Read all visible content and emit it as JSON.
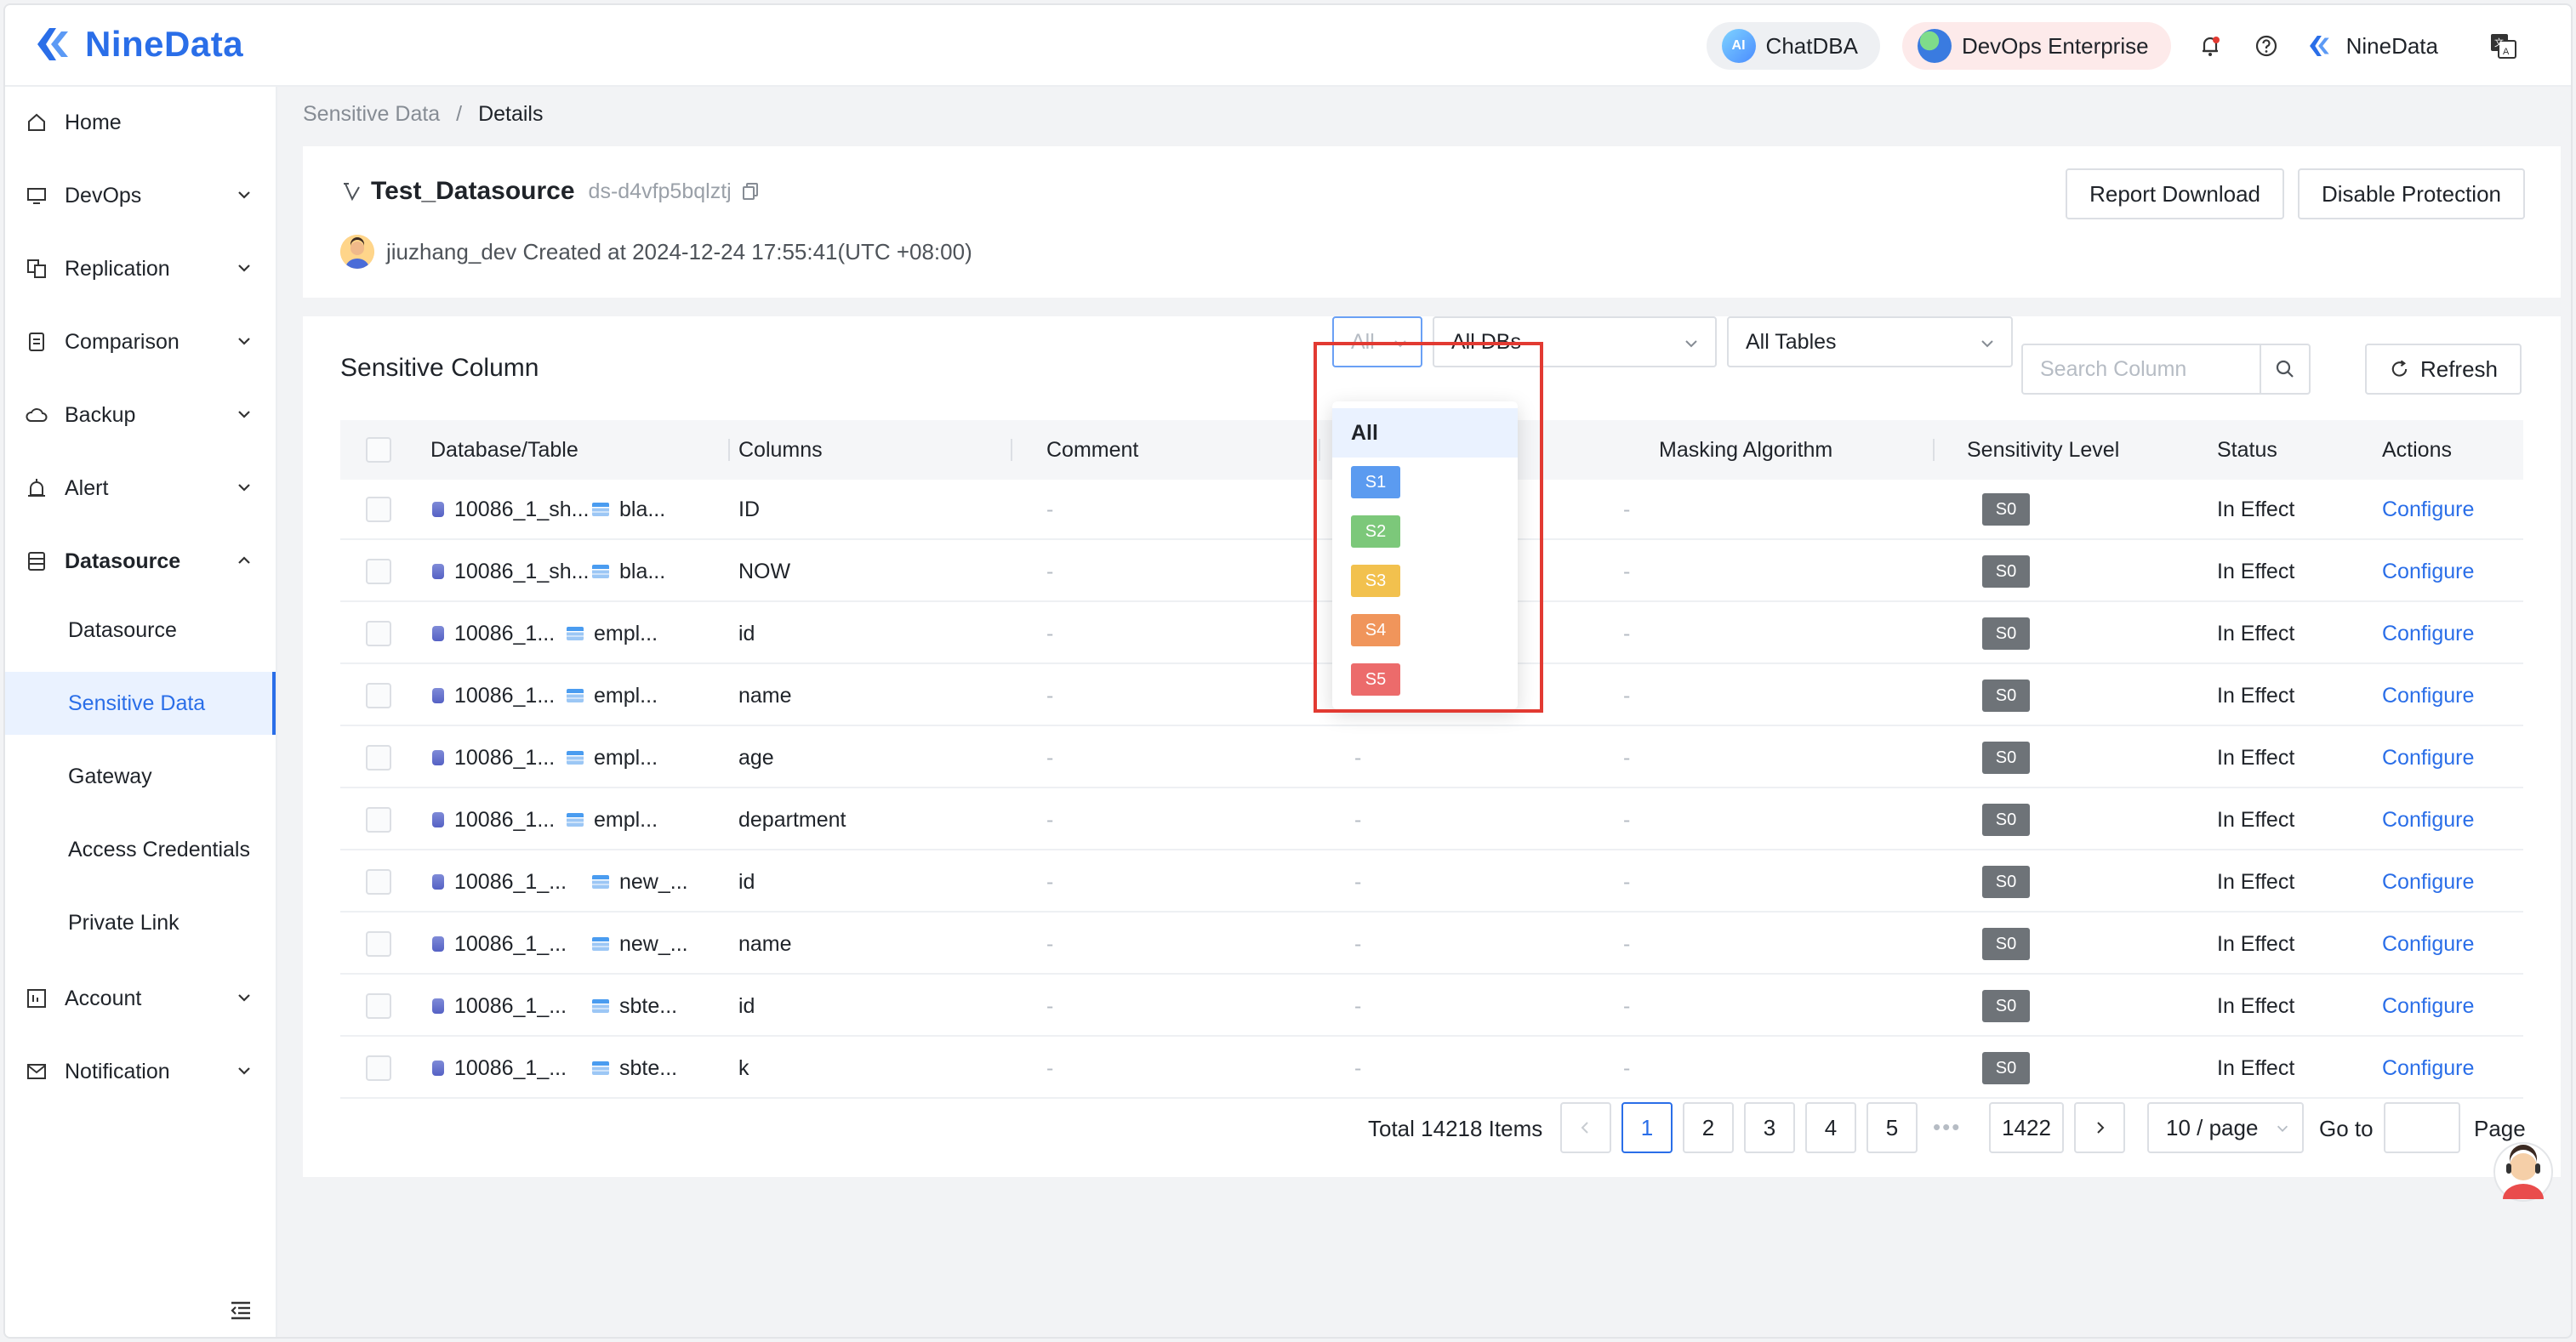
{
  "app": {
    "brand": "NineData",
    "header": {
      "chat_label": "ChatDBA",
      "ai_badge": "AI",
      "enterprise_label": "DevOps Enterprise",
      "user_label": "NineData",
      "notification_icon": "bell-icon",
      "help_icon": "question-icon",
      "language_icon": "translate-icon"
    }
  },
  "sidebar": {
    "items": [
      {
        "label": "Home",
        "icon": "home-icon"
      },
      {
        "label": "DevOps",
        "icon": "monitor-icon"
      },
      {
        "label": "Replication",
        "icon": "replication-icon"
      },
      {
        "label": "Comparison",
        "icon": "compare-icon"
      },
      {
        "label": "Backup",
        "icon": "cloud-icon"
      },
      {
        "label": "Alert",
        "icon": "alarm-icon"
      },
      {
        "label": "Datasource",
        "icon": "database-icon"
      },
      {
        "label": "Account",
        "icon": "account-icon"
      },
      {
        "label": "Notification",
        "icon": "mail-icon"
      }
    ],
    "datasource_sub": [
      "Datasource",
      "Sensitive Data",
      "Gateway",
      "Access Credentials",
      "Private Link"
    ],
    "active_sub": "Sensitive Data"
  },
  "breadcrumb": {
    "parent": "Sensitive Data",
    "sep": "/",
    "current": "Details"
  },
  "datasource": {
    "name": "Test_Datasource",
    "id": "ds-d4vfp5bqlztj",
    "creator_line": "jiuzhang_dev Created at 2024-12-24 17:55:41(UTC +08:00)",
    "report_button": "Report Download",
    "disable_button": "Disable Protection"
  },
  "section": {
    "title": "Sensitive Column",
    "level_filter": "All",
    "db_filter": "All DBs",
    "table_filter": "All Tables",
    "search_placeholder": "Search Column",
    "refresh_label": "Refresh"
  },
  "table": {
    "headers": [
      "Database/Table",
      "Columns",
      "Comment",
      "Masking Algorithm",
      "Sensitivity Level",
      "Status",
      "Actions"
    ],
    "rows": [
      {
        "db": "10086_1_sh...",
        "table": "bla...",
        "column": "ID",
        "comment": "-",
        "classification": "-",
        "masking": "-",
        "level": "S0",
        "status": "In Effect",
        "action": "Configure"
      },
      {
        "db": "10086_1_sh...",
        "table": "bla...",
        "column": "NOW",
        "comment": "-",
        "classification": "-",
        "masking": "-",
        "level": "S0",
        "status": "In Effect",
        "action": "Configure"
      },
      {
        "db": "10086_1...",
        "table": "empl...",
        "column": "id",
        "comment": "-",
        "classification": "-",
        "masking": "-",
        "level": "S0",
        "status": "In Effect",
        "action": "Configure"
      },
      {
        "db": "10086_1...",
        "table": "empl...",
        "column": "name",
        "comment": "-",
        "classification": "-",
        "masking": "-",
        "level": "S0",
        "status": "In Effect",
        "action": "Configure"
      },
      {
        "db": "10086_1...",
        "table": "empl...",
        "column": "age",
        "comment": "-",
        "classification": "-",
        "masking": "-",
        "level": "S0",
        "status": "In Effect",
        "action": "Configure"
      },
      {
        "db": "10086_1...",
        "table": "empl...",
        "column": "department",
        "comment": "-",
        "classification": "-",
        "masking": "-",
        "level": "S0",
        "status": "In Effect",
        "action": "Configure"
      },
      {
        "db": "10086_1_...",
        "table": "new_...",
        "column": "id",
        "comment": "-",
        "classification": "-",
        "masking": "-",
        "level": "S0",
        "status": "In Effect",
        "action": "Configure"
      },
      {
        "db": "10086_1_...",
        "table": "new_...",
        "column": "name",
        "comment": "-",
        "classification": "-",
        "masking": "-",
        "level": "S0",
        "status": "In Effect",
        "action": "Configure"
      },
      {
        "db": "10086_1_...",
        "table": "sbte...",
        "column": "id",
        "comment": "-",
        "classification": "-",
        "masking": "-",
        "level": "S0",
        "status": "In Effect",
        "action": "Configure"
      },
      {
        "db": "10086_1_...",
        "table": "sbte...",
        "column": "k",
        "comment": "-",
        "classification": "-",
        "masking": "-",
        "level": "S0",
        "status": "In Effect",
        "action": "Configure"
      }
    ]
  },
  "pagination": {
    "total": "Total 14218 Items",
    "pages": [
      "1",
      "2",
      "3",
      "4",
      "5"
    ],
    "ellipsis": "•••",
    "last": "1422",
    "current": "1",
    "page_size": "10 / page",
    "goto_label": "Go to",
    "page_label": "Page"
  },
  "level_dropdown": {
    "options": [
      {
        "label": "All"
      },
      {
        "label": "S1",
        "color": "#5b9bf0"
      },
      {
        "label": "S2",
        "color": "#7cc87a"
      },
      {
        "label": "S3",
        "color": "#f2c14e"
      },
      {
        "label": "S4",
        "color": "#f0955b"
      },
      {
        "label": "S5",
        "color": "#ec6b6b"
      }
    ],
    "selected": "All",
    "highlight_color": "#e23a32"
  },
  "colors": {
    "accent": "#2a6ee8",
    "level_badge": "#6e7378"
  }
}
